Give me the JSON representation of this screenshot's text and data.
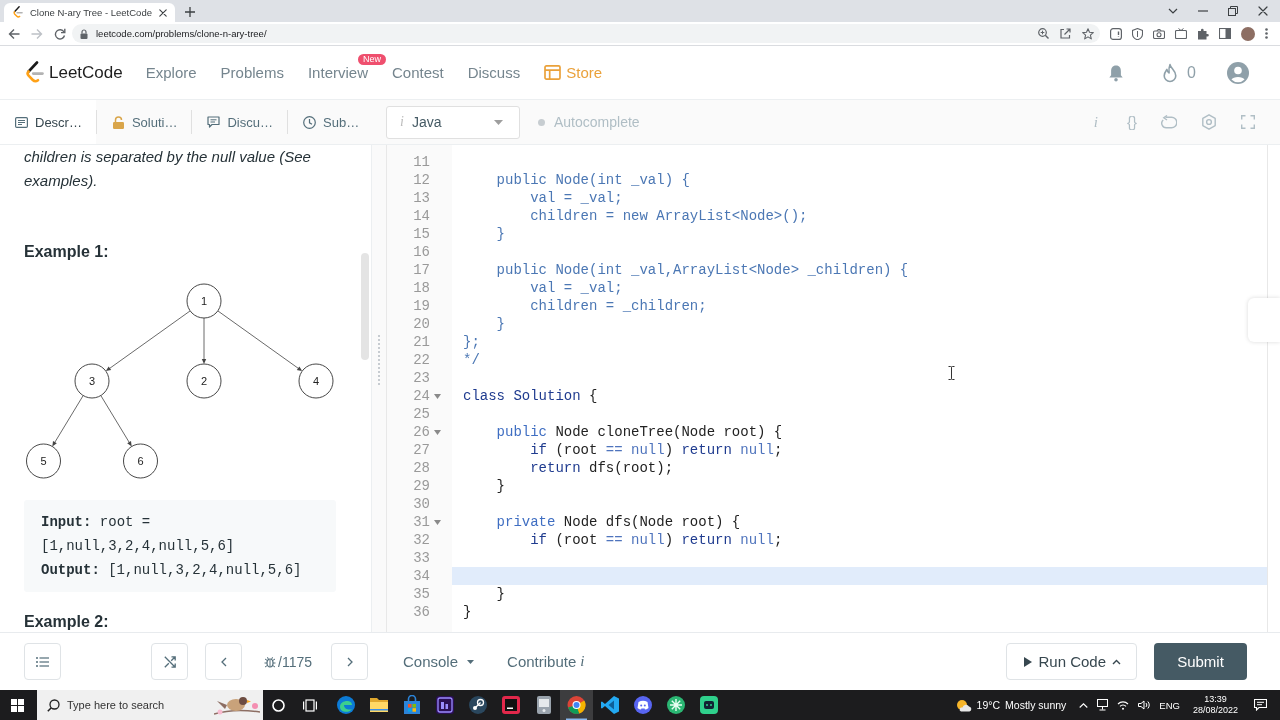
{
  "browser": {
    "tabs": [
      {
        "title": "Clone N-ary Tree - LeetCode",
        "selected": true
      }
    ],
    "url": "leetcode.com/problems/clone-n-ary-tree/"
  },
  "site_nav": {
    "logo": "LeetCode",
    "links": [
      {
        "label": "Explore",
        "kind": "link"
      },
      {
        "label": "Problems",
        "kind": "link"
      },
      {
        "label": "Interview",
        "kind": "link",
        "badge": "New"
      },
      {
        "label": "Contest",
        "kind": "link"
      },
      {
        "label": "Discuss",
        "kind": "link"
      },
      {
        "label": "Store",
        "kind": "store"
      }
    ],
    "streak": "0"
  },
  "panel_tabs": [
    {
      "label": "Descr…",
      "kind": "description",
      "selected": true
    },
    {
      "label": "Soluti…",
      "kind": "solution",
      "selected": false
    },
    {
      "label": "Discu…",
      "kind": "discuss",
      "selected": false
    },
    {
      "label": "Sub…",
      "kind": "submissions",
      "selected": false
    }
  ],
  "editor_toolbar": {
    "language": {
      "hint": "i",
      "value": "Java"
    },
    "autocomplete": {
      "label": "Autocomplete",
      "on": false
    },
    "tools": [
      {
        "kind": "info",
        "glyph": "i"
      },
      {
        "kind": "format",
        "glyph": "{}"
      },
      {
        "kind": "reset"
      },
      {
        "kind": "settings"
      },
      {
        "kind": "fullscreen"
      }
    ]
  },
  "description": {
    "paragraph": "children is separated by the null value (See examples).",
    "sections": [
      {
        "heading": "Example 1:",
        "tree": {
          "label": "1",
          "children": [
            {
              "label": "3",
              "children": [
                {
                  "label": "5"
                },
                {
                  "label": "6"
                }
              ]
            },
            {
              "label": "2"
            },
            {
              "label": "4"
            }
          ]
        },
        "code": [
          "**Input:** root = [1,null,3,2,4,null,5,6]",
          "**Output:** [1,null,3,2,4,null,5,6]"
        ]
      },
      {
        "heading": "Example 2:"
      }
    ]
  },
  "editor": {
    "lines": [
      {
        "number": "11",
        "fold": false,
        "active": false
      },
      {
        "number": "12",
        "fold": false,
        "active": false,
        "tokens": [
          {
            "text": "    public Node(int _val) {",
            "kind": "comment"
          }
        ]
      },
      {
        "number": "13",
        "fold": false,
        "active": false,
        "tokens": [
          {
            "text": "        val = _val;",
            "kind": "comment"
          }
        ]
      },
      {
        "number": "14",
        "fold": false,
        "active": false,
        "tokens": [
          {
            "text": "        children = new ArrayList<Node>();",
            "kind": "comment"
          }
        ]
      },
      {
        "number": "15",
        "fold": false,
        "active": false,
        "tokens": [
          {
            "text": "    }",
            "kind": "comment"
          }
        ]
      },
      {
        "number": "16",
        "fold": false,
        "active": false
      },
      {
        "number": "17",
        "fold": false,
        "active": false,
        "tokens": [
          {
            "text": "    public Node(int _val,ArrayList<Node> _children) {",
            "kind": "comment"
          }
        ]
      },
      {
        "number": "18",
        "fold": false,
        "active": false,
        "tokens": [
          {
            "text": "        val = _val;",
            "kind": "comment"
          }
        ]
      },
      {
        "number": "19",
        "fold": false,
        "active": false,
        "tokens": [
          {
            "text": "        children = _children;",
            "kind": "comment"
          }
        ]
      },
      {
        "number": "20",
        "fold": false,
        "active": false,
        "tokens": [
          {
            "text": "    }",
            "kind": "comment"
          }
        ]
      },
      {
        "number": "21",
        "fold": false,
        "active": false,
        "tokens": [
          {
            "text": "};",
            "kind": "comment"
          }
        ]
      },
      {
        "number": "22",
        "fold": false,
        "active": false,
        "tokens": [
          {
            "text": "*/",
            "kind": "comment"
          }
        ]
      },
      {
        "number": "23",
        "fold": false,
        "active": false
      },
      {
        "number": "24",
        "fold": true,
        "active": false,
        "tokens": [
          {
            "text": "class Solution",
            "kind": "keyword"
          },
          {
            "text": " {",
            "kind": "plain"
          }
        ]
      },
      {
        "number": "25",
        "fold": false,
        "active": false
      },
      {
        "number": "26",
        "fold": true,
        "active": false,
        "tokens": [
          {
            "text": "    public",
            "kind": "modifier"
          },
          {
            "text": " Node cloneTree(Node root) {",
            "kind": "plain"
          }
        ]
      },
      {
        "number": "27",
        "fold": false,
        "active": false,
        "tokens": [
          {
            "text": "        if",
            "kind": "keyword"
          },
          {
            "text": " (root ",
            "kind": "plain"
          },
          {
            "text": "== null",
            "kind": "literal"
          },
          {
            "text": ") ",
            "kind": "plain"
          },
          {
            "text": "return",
            "kind": "keyword"
          },
          {
            "text": " null",
            "kind": "literal"
          },
          {
            "text": ";",
            "kind": "plain"
          }
        ]
      },
      {
        "number": "28",
        "fold": false,
        "active": false,
        "tokens": [
          {
            "text": "        return",
            "kind": "keyword"
          },
          {
            "text": " dfs(root);",
            "kind": "plain"
          }
        ]
      },
      {
        "number": "29",
        "fold": false,
        "active": false,
        "tokens": [
          {
            "text": "    }",
            "kind": "plain"
          }
        ]
      },
      {
        "number": "30",
        "fold": false,
        "active": false
      },
      {
        "number": "31",
        "fold": true,
        "active": false,
        "tokens": [
          {
            "text": "    private",
            "kind": "modifier"
          },
          {
            "text": " Node dfs(Node root) {",
            "kind": "plain"
          }
        ]
      },
      {
        "number": "32",
        "fold": false,
        "active": false,
        "tokens": [
          {
            "text": "        if",
            "kind": "keyword"
          },
          {
            "text": " (root ",
            "kind": "plain"
          },
          {
            "text": "== null",
            "kind": "literal"
          },
          {
            "text": ") ",
            "kind": "plain"
          },
          {
            "text": "return",
            "kind": "keyword"
          },
          {
            "text": " null",
            "kind": "literal"
          },
          {
            "text": ";",
            "kind": "plain"
          }
        ]
      },
      {
        "number": "33",
        "fold": false,
        "active": false
      },
      {
        "number": "34",
        "fold": false,
        "active": true
      },
      {
        "number": "35",
        "fold": false,
        "active": false,
        "tokens": [
          {
            "text": "    }",
            "kind": "plain"
          }
        ]
      },
      {
        "number": "36",
        "fold": false,
        "active": false,
        "tokens": [
          {
            "text": "}",
            "kind": "plain"
          }
        ]
      }
    ]
  },
  "bottom_bar": {
    "counter": "/1175",
    "console": "Console",
    "contribute": {
      "label": "Contribute",
      "hint": "i"
    },
    "run": "Run Code",
    "submit": "Submit"
  },
  "taskbar": {
    "search": {
      "placeholder": "Type here to search"
    },
    "apps": [
      {
        "kind": "swirl",
        "selected": false
      },
      {
        "kind": "folder",
        "selected": false
      },
      {
        "kind": "bag",
        "selected": false
      },
      {
        "kind": "tile",
        "selected": false
      },
      {
        "kind": "disc",
        "selected": false
      },
      {
        "kind": "redtile",
        "selected": false
      },
      {
        "kind": "device",
        "selected": false
      },
      {
        "kind": "chrome",
        "selected": true
      },
      {
        "kind": "ribbon",
        "selected": false
      },
      {
        "kind": "gamepad",
        "selected": false
      },
      {
        "kind": "roundapp",
        "selected": false
      },
      {
        "kind": "robot",
        "selected": false
      }
    ],
    "weather": {
      "temperature": "19°C",
      "condition": "Mostly sunny"
    },
    "language": "ENG",
    "time": "13:39",
    "date": "28/08/2022"
  }
}
